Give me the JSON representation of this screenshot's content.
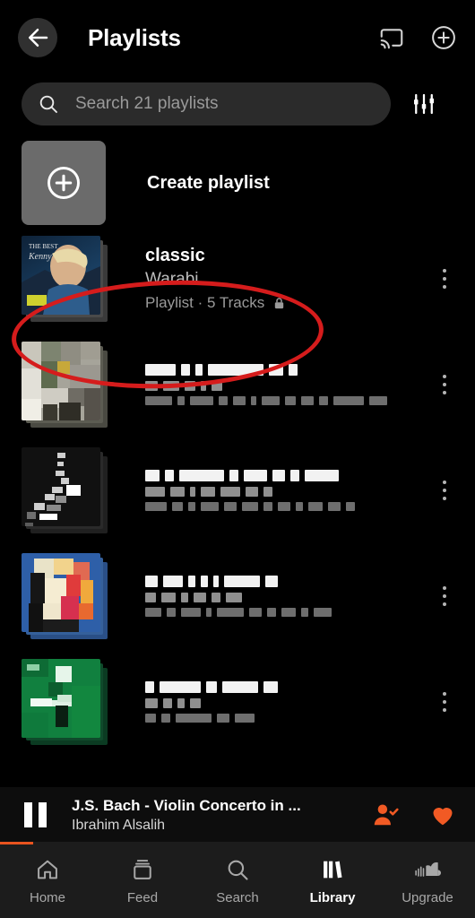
{
  "header": {
    "title": "Playlists",
    "back_icon": "arrow-left-icon",
    "cast_icon": "cast-icon",
    "add_icon": "plus-circle-icon"
  },
  "search": {
    "placeholder": "Search 21 playlists",
    "search_icon": "search-icon",
    "filter_icon": "sliders-filter-icon",
    "playlist_count": 21
  },
  "create": {
    "label": "Create playlist",
    "icon": "plus-circle-icon",
    "tile_color": "#6b6b6b"
  },
  "playlists": [
    {
      "title": "classic",
      "owner": "Warabi",
      "meta": "Playlist · 5 Tracks",
      "track_count": 5,
      "private": true,
      "lock_icon": "lock-icon",
      "redacted": false,
      "menu_icon": "kebab-menu-icon",
      "highlighted": true
    },
    {
      "title": "",
      "owner": "",
      "meta": "",
      "redacted": true,
      "menu_icon": "kebab-menu-icon",
      "highlighted": false,
      "title_blocks": [
        34,
        10,
        8,
        62,
        16,
        10
      ],
      "owner_blocks": [
        14,
        18,
        12,
        6,
        12
      ],
      "meta_blocks": [
        30,
        8,
        26,
        10,
        14,
        6,
        20,
        12,
        14,
        10,
        34,
        20,
        10,
        16
      ]
    },
    {
      "title": "",
      "owner": "",
      "meta": "",
      "redacted": true,
      "menu_icon": "kebab-menu-icon",
      "highlighted": false,
      "title_blocks": [
        16,
        10,
        50,
        10,
        26,
        14,
        10,
        38
      ],
      "owner_blocks": [
        22,
        16,
        6,
        16,
        22,
        14,
        10,
        12
      ],
      "meta_blocks": [
        24,
        12,
        8,
        20,
        14,
        18,
        10,
        14,
        8,
        16,
        14,
        10,
        22,
        12
      ]
    },
    {
      "title": "",
      "owner": "",
      "meta": "",
      "redacted": true,
      "menu_icon": "kebab-menu-icon",
      "highlighted": false,
      "title_blocks": [
        14,
        22,
        8,
        8,
        6,
        40,
        14
      ],
      "owner_blocks": [
        12,
        16,
        8,
        14,
        10,
        18,
        10
      ],
      "meta_blocks": [
        18,
        10,
        22,
        6,
        30,
        14,
        10,
        16,
        8,
        20
      ]
    },
    {
      "title": "",
      "owner": "",
      "meta": "",
      "redacted": true,
      "menu_icon": "kebab-menu-icon",
      "highlighted": false,
      "title_blocks": [
        10,
        46,
        12,
        40,
        16
      ],
      "owner_blocks": [
        14,
        10,
        8,
        12
      ],
      "meta_blocks": [
        12,
        10,
        40,
        14,
        22
      ]
    }
  ],
  "player": {
    "pause_icon": "pause-icon",
    "track_title": "J.S. Bach  -  Violin Concerto in ...",
    "artist": "Ibrahim Alsalih",
    "follow_icon": "user-check-icon",
    "like_icon": "heart-filled-icon",
    "accent_color": "#f15a24",
    "progress_percent": 7
  },
  "nav": {
    "items": [
      {
        "label": "Home",
        "icon": "home-icon",
        "active": false
      },
      {
        "label": "Feed",
        "icon": "feed-icon",
        "active": false
      },
      {
        "label": "Search",
        "icon": "search-icon",
        "active": false
      },
      {
        "label": "Library",
        "icon": "library-icon",
        "active": true
      },
      {
        "label": "Upgrade",
        "icon": "cloud-soundcloud-icon",
        "active": false
      }
    ]
  },
  "annotation": {
    "shape": "ellipse",
    "color": "#d51c1c",
    "target": "classic"
  }
}
